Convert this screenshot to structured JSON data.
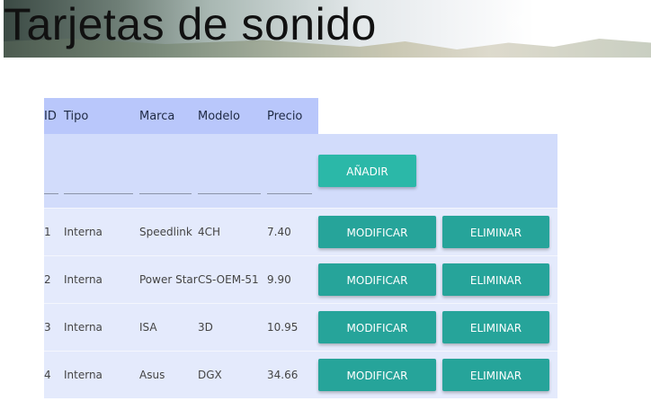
{
  "page": {
    "title": "Tarjetas de sonido"
  },
  "table": {
    "headers": {
      "id": "ID",
      "tipo": "Tipo",
      "marca": "Marca",
      "modelo": "Modelo",
      "precio": "Precio"
    },
    "add_row": {
      "id_value": "",
      "tipo_value": "",
      "marca_value": "",
      "modelo_value": "",
      "precio_value": "",
      "add_label": "AÑADIR"
    },
    "rows": [
      {
        "id": "1",
        "tipo": "Interna",
        "marca": "Speedlink",
        "modelo": "4CH",
        "precio": "7.40",
        "modify_label": "MODIFICAR",
        "delete_label": "ELIMINAR"
      },
      {
        "id": "2",
        "tipo": "Interna",
        "marca": "Power Star",
        "modelo": "CS-OEM-51",
        "precio": "9.90",
        "modify_label": "MODIFICAR",
        "delete_label": "ELIMINAR"
      },
      {
        "id": "3",
        "tipo": "Interna",
        "marca": "ISA",
        "modelo": "3D",
        "precio": "10.95",
        "modify_label": "MODIFICAR",
        "delete_label": "ELIMINAR"
      },
      {
        "id": "4",
        "tipo": "Interna",
        "marca": "Asus",
        "modelo": "DGX",
        "precio": "34.66",
        "modify_label": "MODIFICAR",
        "delete_label": "ELIMINAR"
      }
    ]
  },
  "colors": {
    "header_bg": "#b9c7fb",
    "add_row_bg": "#d2dcfb",
    "row_bg": "#e4eafc",
    "button_teal": "#26a49a",
    "add_button": "#2bb8a8"
  }
}
